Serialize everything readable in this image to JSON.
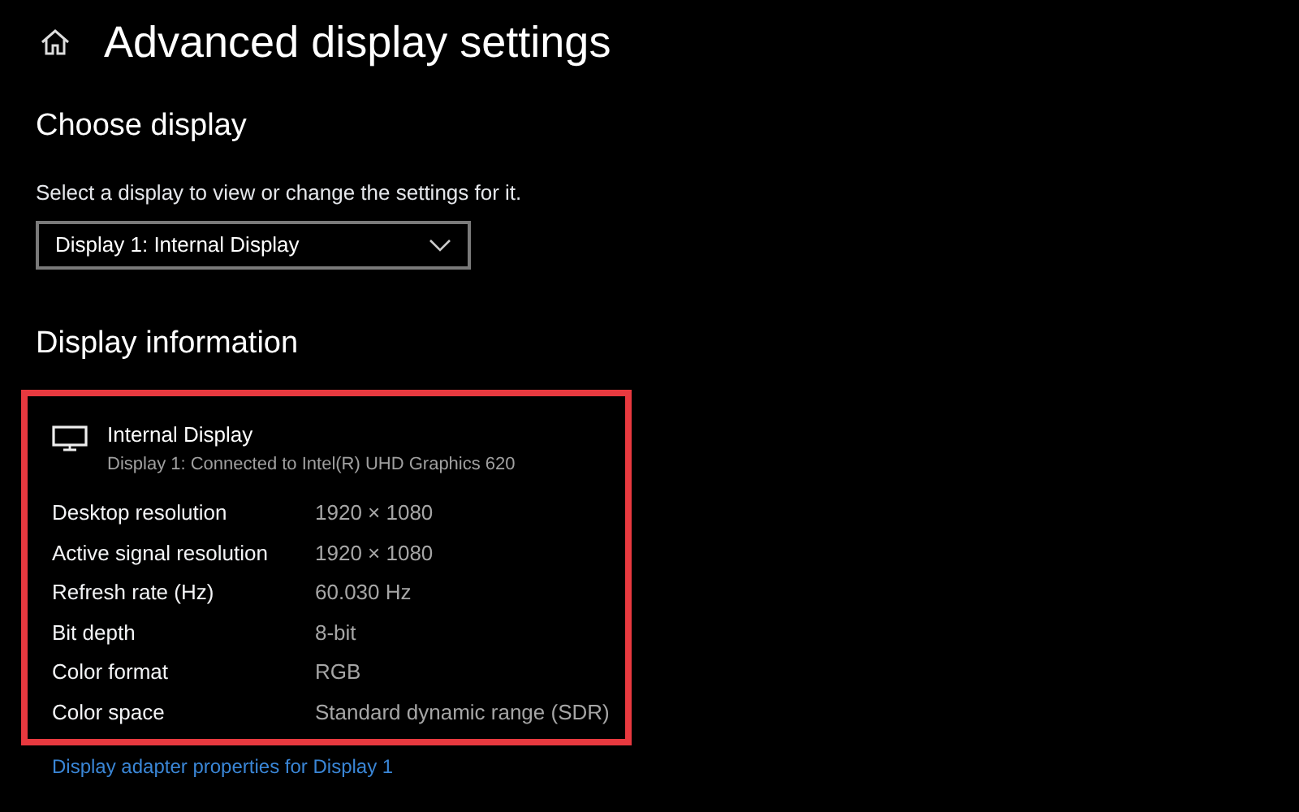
{
  "page": {
    "title": "Advanced display settings"
  },
  "choose_display": {
    "heading": "Choose display",
    "description": "Select a display to view or change the settings for it.",
    "dropdown": {
      "value": "Display 1: Internal Display"
    }
  },
  "display_information": {
    "heading": "Display information",
    "display_name": "Internal Display",
    "connection": "Display 1: Connected to Intel(R) UHD Graphics 620",
    "rows": [
      {
        "label": "Desktop resolution",
        "value": "1920 × 1080"
      },
      {
        "label": "Active signal resolution",
        "value": "1920 × 1080"
      },
      {
        "label": "Refresh rate (Hz)",
        "value": "60.030 Hz"
      },
      {
        "label": "Bit depth",
        "value": "8-bit"
      },
      {
        "label": "Color format",
        "value": "RGB"
      },
      {
        "label": "Color space",
        "value": "Standard dynamic range (SDR)"
      }
    ],
    "link": "Display adapter properties for Display 1"
  }
}
